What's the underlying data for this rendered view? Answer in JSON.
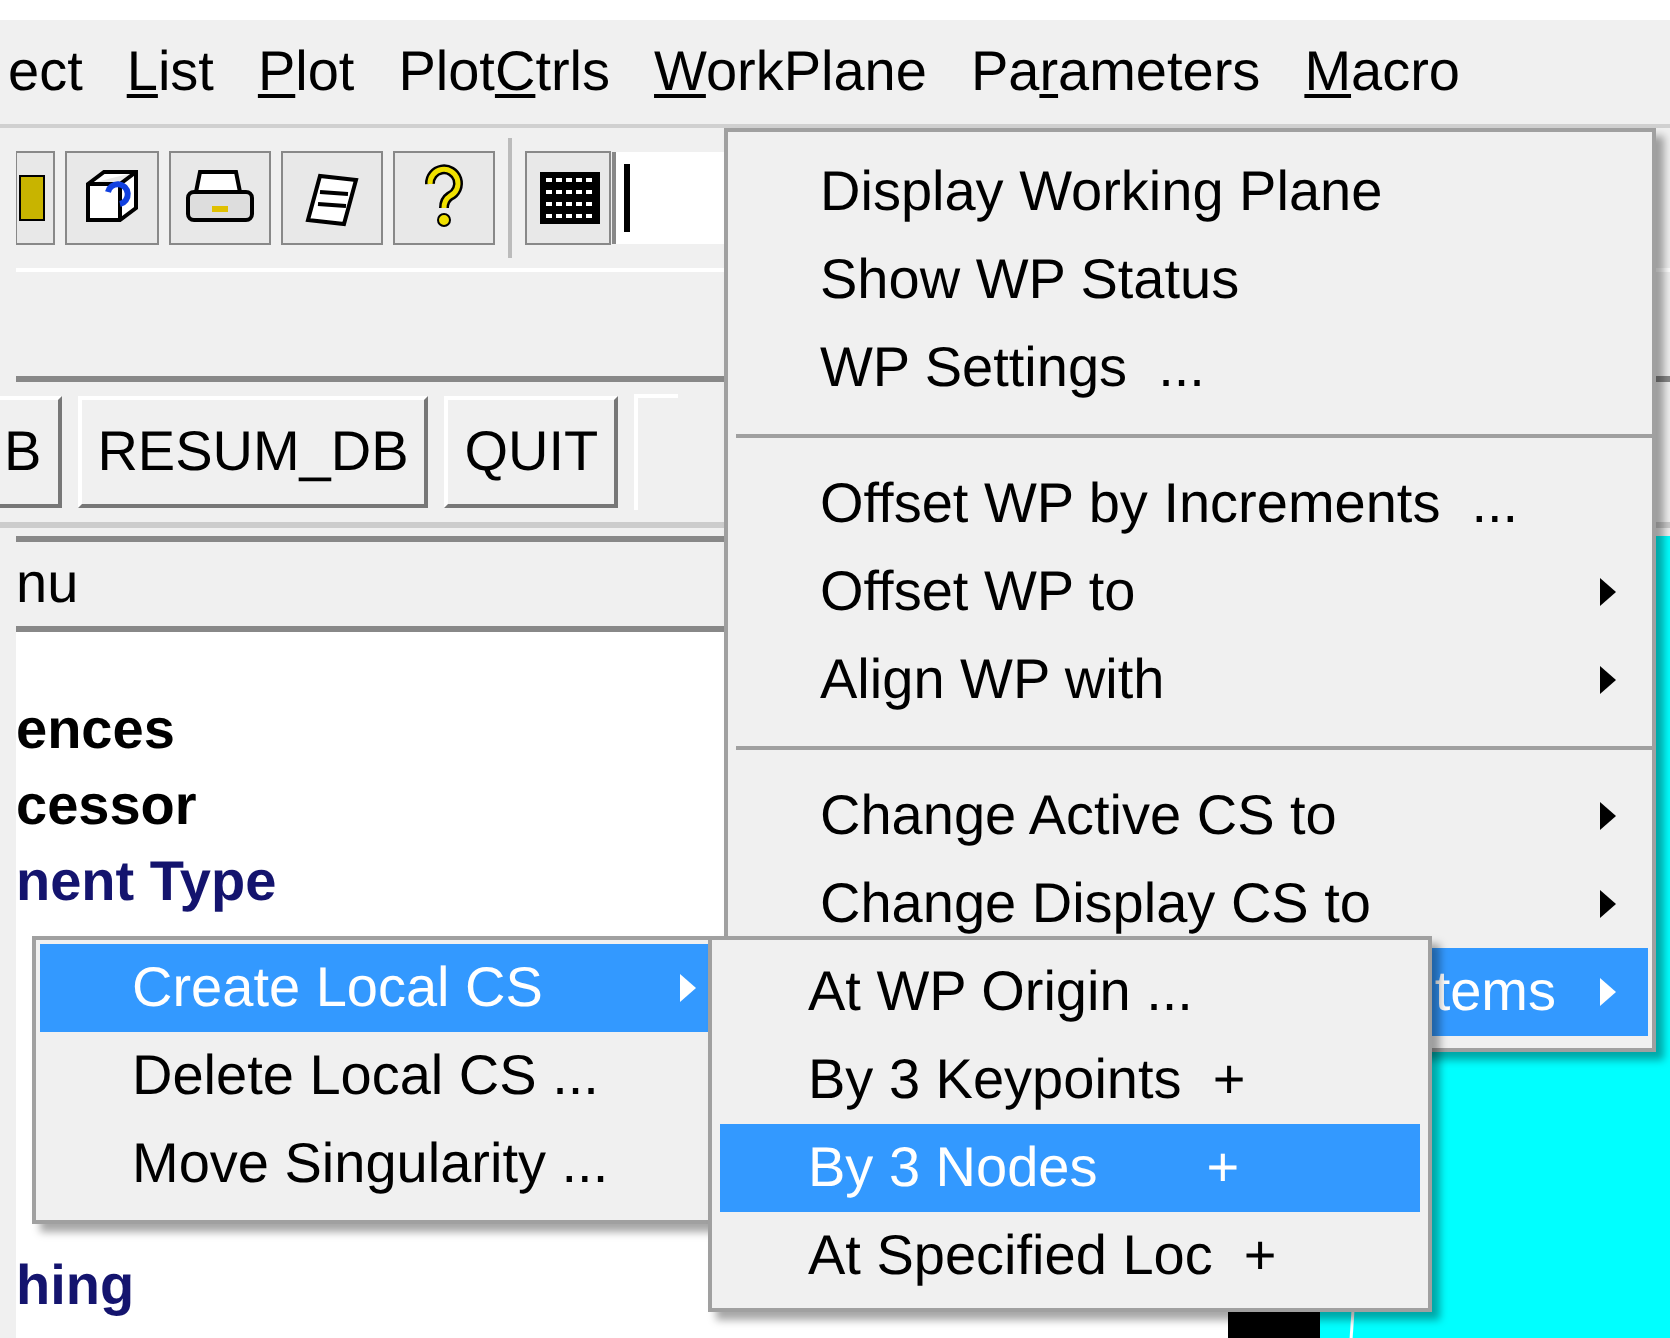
{
  "menubar": [
    {
      "pre": "ect"
    },
    {
      "key": "L",
      "post": "ist"
    },
    {
      "key": "P",
      "post": "lot"
    },
    {
      "pre": "Plot",
      "key": "C",
      "post": "trls"
    },
    {
      "key": "W",
      "post": "orkPlane"
    },
    {
      "pre": "Pa",
      "key": "r",
      "post": "ameters"
    },
    {
      "key": "M",
      "post": "acro"
    }
  ],
  "toolbar_buttons": [
    "B",
    "RESUM_DB",
    "QUIT"
  ],
  "main_menu": {
    "title": "nu",
    "items": [
      {
        "label": "ences",
        "color": "#000000"
      },
      {
        "label": "cessor",
        "color": "#000000"
      },
      {
        "label": "nent Type",
        "color": "#14146e"
      },
      {
        "label": "hing",
        "color": "#14146e"
      }
    ]
  },
  "workplane_menu": {
    "items": [
      {
        "kind": "item",
        "label": "Display Working Plane",
        "submenu": false,
        "selected": false
      },
      {
        "kind": "item",
        "label": "Show WP Status",
        "submenu": false,
        "selected": false
      },
      {
        "kind": "item",
        "label": "WP Settings  ...",
        "submenu": false,
        "selected": false
      },
      {
        "kind": "separator"
      },
      {
        "kind": "item",
        "label": "Offset WP by Increments  ...",
        "submenu": false,
        "selected": false
      },
      {
        "kind": "item",
        "label": "Offset WP to",
        "submenu": true,
        "selected": false
      },
      {
        "kind": "item",
        "label": "Align WP with",
        "submenu": true,
        "selected": false
      },
      {
        "kind": "separator"
      },
      {
        "kind": "item",
        "label": "Change Active CS to",
        "submenu": true,
        "selected": false
      },
      {
        "kind": "item",
        "label": "Change Display CS to",
        "submenu": true,
        "selected": false
      },
      {
        "kind": "partial",
        "label": "tems",
        "submenu": true,
        "selected": true
      }
    ]
  },
  "local_cs_menu": {
    "items": [
      {
        "label": "Create Local CS",
        "submenu": true,
        "selected": true
      },
      {
        "label": "Delete Local CS ...",
        "submenu": false,
        "selected": false
      },
      {
        "label": "Move Singularity ...",
        "submenu": false,
        "selected": false
      }
    ]
  },
  "create_cs_menu": {
    "items": [
      {
        "label": "At WP Origin ...",
        "selected": false
      },
      {
        "label": "By 3 Keypoints  +",
        "selected": false
      },
      {
        "label": "By 3 Nodes       +",
        "selected": true
      },
      {
        "label": "At Specified Loc  +",
        "selected": false
      }
    ]
  }
}
